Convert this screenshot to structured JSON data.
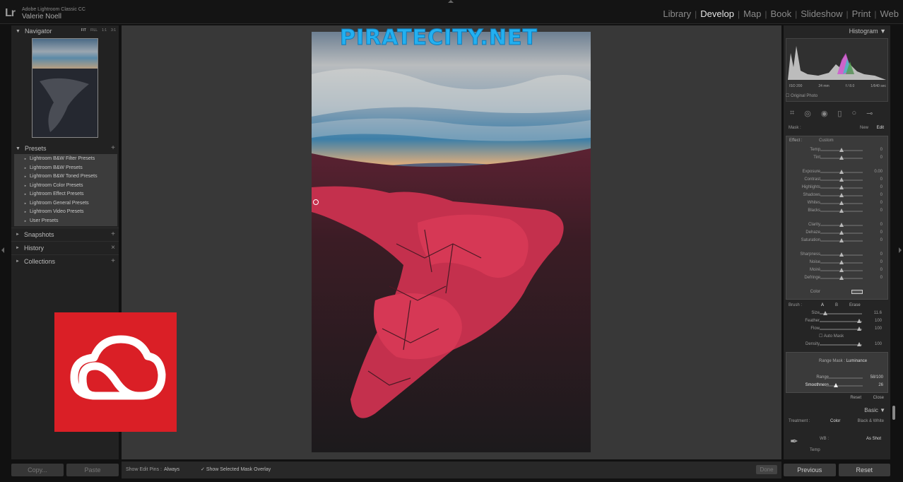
{
  "topbar": {
    "logo": "Lr",
    "app_name": "Adobe Lightroom Classic CC",
    "user": "Valerie Noell",
    "modules": [
      "Library",
      "Develop",
      "Map",
      "Book",
      "Slideshow",
      "Print",
      "Web"
    ],
    "active_module": "Develop"
  },
  "left": {
    "navigator": {
      "title": "Navigator",
      "options": [
        "FIT",
        "FILL",
        "1:1",
        "3:1"
      ]
    },
    "presets": {
      "title": "Presets",
      "items": [
        "Lightroom B&W Filter Presets",
        "Lightroom B&W Presets",
        "Lightroom B&W Toned Presets",
        "Lightroom Color Presets",
        "Lightroom Effect Presets",
        "Lightroom General Presets",
        "Lightroom Video Presets",
        "User Presets"
      ]
    },
    "snapshots": "Snapshots",
    "history": "History",
    "collections": "Collections",
    "copy_btn": "Copy...",
    "paste_btn": "Paste"
  },
  "watermark": "PIRATECITY.NET",
  "toolbar": {
    "pins_label": "Show Edit Pins :",
    "pins_value": "Always",
    "overlay": "Show Selected Mask Overlay",
    "done": "Done"
  },
  "right": {
    "histogram_title": "Histogram",
    "hist_meta": [
      "ISO 200",
      "24 mm",
      "f / 8.0",
      "1/640 sec"
    ],
    "original": "Original Photo",
    "mask": {
      "label": "Mask :",
      "new": "New",
      "edit": "Edit"
    },
    "effect": {
      "label": "Effect :",
      "value": "Custom"
    },
    "adjustments": [
      {
        "name": "Temp",
        "value": "0"
      },
      {
        "name": "Tint",
        "value": "0"
      },
      {
        "name": "Exposure",
        "value": "0.00"
      },
      {
        "name": "Contrast",
        "value": "0"
      },
      {
        "name": "Highlights",
        "value": "0"
      },
      {
        "name": "Shadows",
        "value": "0"
      },
      {
        "name": "Whites",
        "value": "0"
      },
      {
        "name": "Blacks",
        "value": "0"
      },
      {
        "name": "Clarity",
        "value": "0"
      },
      {
        "name": "Dehaze",
        "value": "0"
      },
      {
        "name": "Saturation",
        "value": "0"
      },
      {
        "name": "Sharpness",
        "value": "0"
      },
      {
        "name": "Noise",
        "value": "0"
      },
      {
        "name": "Moiré",
        "value": "0"
      },
      {
        "name": "Defringe",
        "value": "0"
      },
      {
        "name": "Color",
        "value": ""
      }
    ],
    "brush": {
      "label": "Brush :",
      "a": "A",
      "b": "B",
      "erase": "Erase",
      "size": {
        "name": "Size",
        "value": "11.6"
      },
      "feather": {
        "name": "Feather",
        "value": "100"
      },
      "flow": {
        "name": "Flow",
        "value": "100"
      },
      "automask": "Auto Mask",
      "density": {
        "name": "Density",
        "value": "100"
      }
    },
    "range": {
      "label": "Range Mask :",
      "value": "Luminance",
      "range": {
        "name": "Range",
        "value": "58/100"
      },
      "smoothness": {
        "name": "Smoothness",
        "value": "26"
      }
    },
    "reset": "Reset",
    "close": "Close",
    "basic": "Basic",
    "treatment": {
      "label": "Treatment :",
      "color": "Color",
      "bw": "Black & White"
    },
    "wb": {
      "label": "WB :",
      "value": "As Shot",
      "temp": "Temp"
    },
    "previous_btn": "Previous",
    "reset_btn": "Reset"
  }
}
